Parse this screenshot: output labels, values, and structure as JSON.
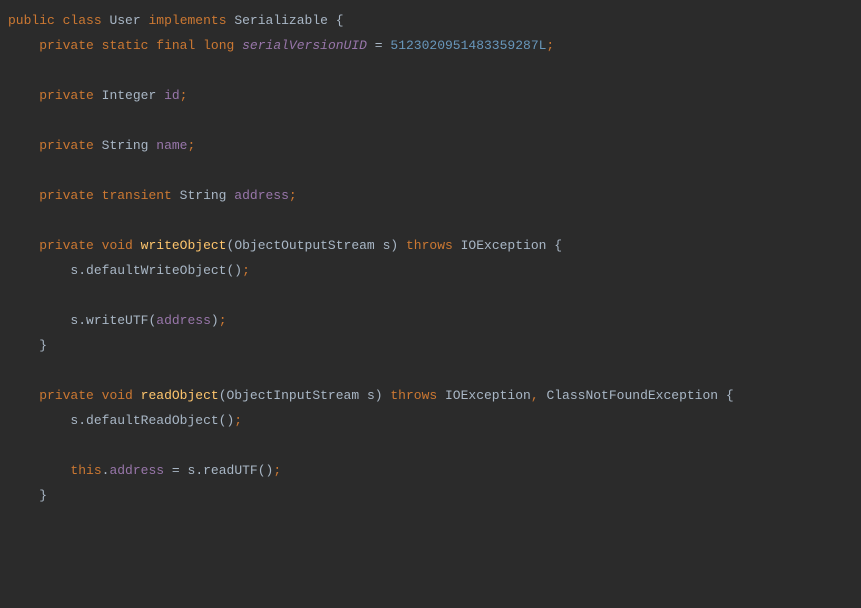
{
  "code": {
    "l1": {
      "t1": "public",
      "t2": "class",
      "t3": "User",
      "t4": "implements",
      "t5": "Serializable",
      "t6": "{"
    },
    "l2": {
      "t1": "private",
      "t2": "static",
      "t3": "final",
      "t4": "long",
      "t5": "serialVersionUID",
      "t6": "=",
      "t7": "5123020951483359287L",
      "t8": ";"
    },
    "l4": {
      "t1": "private",
      "t2": "Integer",
      "t3": "id",
      "t4": ";"
    },
    "l6": {
      "t1": "private",
      "t2": "String",
      "t3": "name",
      "t4": ";"
    },
    "l8": {
      "t1": "private",
      "t2": "transient",
      "t3": "String",
      "t4": "address",
      "t5": ";"
    },
    "l10": {
      "t1": "private",
      "t2": "void",
      "t3": "writeObject",
      "t4": "(",
      "t5": "ObjectOutputStream",
      "t6": "s",
      "t7": ")",
      "t8": "throws",
      "t9": "IOException",
      "t10": "{"
    },
    "l11": {
      "t1": "s",
      "t2": ".",
      "t3": "defaultWriteObject",
      "t4": "()",
      "t5": ";"
    },
    "l13": {
      "t1": "s",
      "t2": ".",
      "t3": "writeUTF",
      "t4": "(",
      "t5": "address",
      "t6": ")",
      "t7": ";"
    },
    "l14": {
      "t1": "}"
    },
    "l16": {
      "t1": "private",
      "t2": "void",
      "t3": "readObject",
      "t4": "(",
      "t5": "ObjectInputStream",
      "t6": "s",
      "t7": ")",
      "t8": "throws",
      "t9": "IOException",
      "t10": ",",
      "t11": "ClassNotFoundException",
      "t12": "{"
    },
    "l17": {
      "t1": "s",
      "t2": ".",
      "t3": "defaultReadObject",
      "t4": "()",
      "t5": ";"
    },
    "l19": {
      "t1": "this",
      "t2": ".",
      "t3": "address",
      "t4": "=",
      "t5": "s",
      "t6": ".",
      "t7": "readUTF",
      "t8": "()",
      "t9": ";"
    },
    "l20": {
      "t1": "}"
    }
  }
}
